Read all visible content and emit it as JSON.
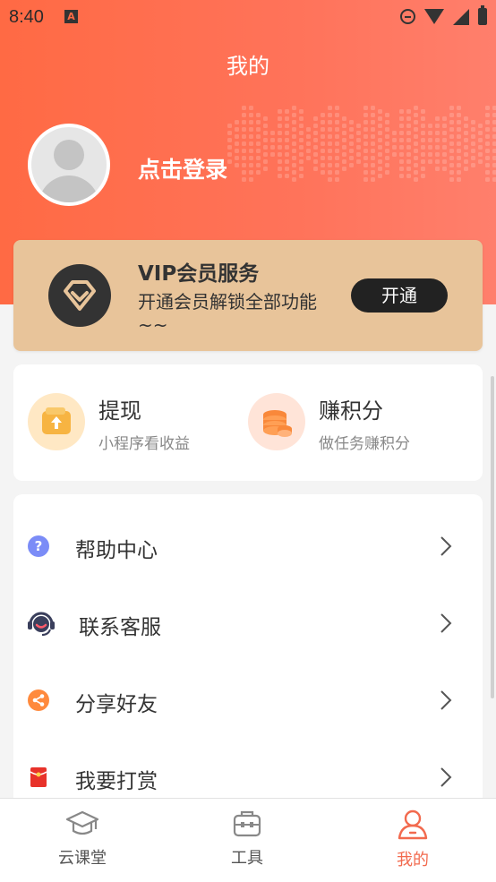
{
  "status_bar": {
    "time": "8:40",
    "notif_icon": "A"
  },
  "header": {
    "title": "我的"
  },
  "profile": {
    "login_text": "点击登录"
  },
  "vip": {
    "title": "VIP会员服务",
    "description": "开通会员解锁全部功能~~",
    "button_label": "开通"
  },
  "quick_actions": [
    {
      "title": "提现",
      "subtitle": "小程序看收益",
      "icon": "wallet-icon"
    },
    {
      "title": "赚积分",
      "subtitle": "做任务赚积分",
      "icon": "coins-icon"
    }
  ],
  "menu": [
    {
      "label": "帮助中心",
      "icon": "help-icon"
    },
    {
      "label": "联系客服",
      "icon": "headset-icon"
    },
    {
      "label": "分享好友",
      "icon": "share-icon"
    },
    {
      "label": "我要打赏",
      "icon": "red-envelope-icon"
    }
  ],
  "tabs": [
    {
      "label": "云课堂",
      "icon": "graduation-cap-icon",
      "active": false
    },
    {
      "label": "工具",
      "icon": "toolbox-icon",
      "active": false
    },
    {
      "label": "我的",
      "icon": "user-icon",
      "active": true
    }
  ],
  "colors": {
    "accent": "#ff6a44",
    "vip_background": "#e8c49a",
    "active_tab": "#f26a4e"
  }
}
